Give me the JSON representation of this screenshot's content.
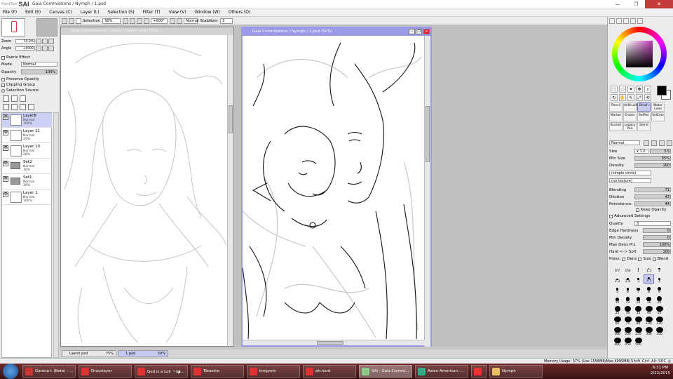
{
  "app": {
    "logo_small": "PaintTool",
    "logo": "SAI",
    "title": "Gaia Commissions / Nymph / 1.psd"
  },
  "menu": [
    "File (F)",
    "Edit (E)",
    "Canvas (C)",
    "Layer (L)",
    "Selection (S)",
    "Filter (T)",
    "View (V)",
    "Window (W)",
    "Others (O)"
  ],
  "toolbar": {
    "selection_label": "Selection",
    "zoom": "50%",
    "rotation": "+000°",
    "blend_mode": "Normal",
    "stabilizer_label": "Stabilizer",
    "stabilizer_value": "3"
  },
  "navigator": {
    "zoom_label": "Zoom",
    "zoom_value": "50.0%",
    "angle_label": "Angle",
    "angle_value": "+0000"
  },
  "layer_props": {
    "paints_effect": "Paints Effect",
    "mode_label": "Mode",
    "mode_value": "Normal",
    "opacity_label": "Opacity",
    "opacity_value": "100%",
    "preserve_opacity": "Preserve Opacity",
    "clipping_group": "Clipping Group",
    "selection_source": "Selection Source"
  },
  "layers": [
    {
      "name": "Layer8",
      "mode": "Normal",
      "opacity": "100%",
      "type": "layer",
      "active": true
    },
    {
      "name": "Layer 11",
      "mode": "Normal",
      "opacity": "35%",
      "type": "layer",
      "active": false
    },
    {
      "name": "Layer 10",
      "mode": "Normal",
      "opacity": "28%",
      "type": "layer",
      "active": false
    },
    {
      "name": "Set2",
      "mode": "Normal",
      "opacity": "10%",
      "type": "set",
      "active": false
    },
    {
      "name": "Set1",
      "mode": "Normal",
      "opacity": "19%",
      "type": "set",
      "active": false
    },
    {
      "name": "Layer 1",
      "mode": "Normal",
      "opacity": "100%",
      "type": "layer",
      "active": false
    }
  ],
  "windows": {
    "win1_title": "Gaia Commissions / Laenri / Laenri.psd (75%)",
    "win2_title": "Gaia Commissions / Nymph / 1.psd (50%)"
  },
  "doc_tabs": [
    {
      "name": "Laenri.psd",
      "pct": "75%",
      "active": false
    },
    {
      "name": "1.psd",
      "pct": "50%",
      "active": true
    }
  ],
  "brushes": [
    {
      "name": "Pencil",
      "active": false
    },
    {
      "name": "AirBrush",
      "active": false
    },
    {
      "name": "Brush",
      "active": true
    },
    {
      "name": "Water Color",
      "active": false
    },
    {
      "name": "Marker",
      "active": false
    },
    {
      "name": "Eraser",
      "active": false
    },
    {
      "name": "SelPen",
      "active": false
    },
    {
      "name": "SelEras",
      "active": false
    },
    {
      "name": "Bucket",
      "active": false
    },
    {
      "name": "Legacy Pen",
      "active": false
    },
    {
      "name": "blend",
      "active": false
    }
  ],
  "brush_settings": {
    "mode": "Normal",
    "size_label": "Size",
    "size_mult": "x 1.0",
    "size_value": "3.5",
    "min_size_label": "Min Size",
    "min_size_value": "55%",
    "density_label": "Density",
    "density_value": "100",
    "shape": "(simple circle)",
    "texture": "(no texture)",
    "blending_label": "Blending",
    "blending_value": "71",
    "dilution_label": "Dilution",
    "dilution_value": "43",
    "persistence_label": "Persistence",
    "persistence_value": "44",
    "keep_opacity": "Keep Opacity",
    "advanced": "Advanced Settings",
    "quality_label": "Quality",
    "quality_value": "3",
    "edge_label": "Edge Hardness",
    "edge_value": "0",
    "min_density_label": "Min Density",
    "min_density_value": "0",
    "max_dens_label": "Max Dens Prs.",
    "max_dens_value": "100%",
    "hard_soft_label": "Hard <-> Soft",
    "hard_soft_value": "100",
    "press_label": "Press:",
    "press_dens": "Dens",
    "press_size": "Size",
    "press_blend": "Blend"
  },
  "brush_sizes": [
    "0.7",
    "0.8",
    "1",
    "1.5",
    "2",
    "2.3",
    "2.6",
    "3",
    "3.5",
    "4",
    "5",
    "6",
    "7",
    "8",
    "9",
    "10",
    "12",
    "14",
    "16",
    "20",
    "25",
    "30",
    "35",
    "40",
    "50",
    "60",
    "70",
    "80",
    "100",
    "120",
    "160",
    "200",
    "250",
    "300",
    "350",
    "400",
    "450",
    "500"
  ],
  "status": {
    "memory": "Memory Usage: 37% (Use 1556MB/Max 4095MB)",
    "keys": "Shift Ctrl Alt SPC ◎ Any"
  },
  "taskbar": {
    "items": [
      {
        "label": "Garena+ (Beta) - ...",
        "color": "#c33",
        "active": false
      },
      {
        "label": "Drayslayer",
        "color": "#d33",
        "active": false
      },
      {
        "label": "God is a Loli ヽ(◕...",
        "color": "#d33",
        "active": false
      },
      {
        "label": "Tatooine",
        "color": "#d33",
        "active": false
      },
      {
        "label": "kingyem",
        "color": "#d33",
        "active": false
      },
      {
        "label": "ah-nerd",
        "color": "#d33",
        "active": false
      },
      {
        "label": "SAI - Gaia Commi...",
        "color": "#8c8",
        "active": true
      },
      {
        "label": "Asian American: ...",
        "color": "#3a8",
        "active": false
      },
      {
        "label": "",
        "color": "#e33",
        "active": false
      },
      {
        "label": "Nymph",
        "color": "#e8c060",
        "active": false
      }
    ],
    "time": "6:31 PM",
    "date": "2/22/2015"
  }
}
